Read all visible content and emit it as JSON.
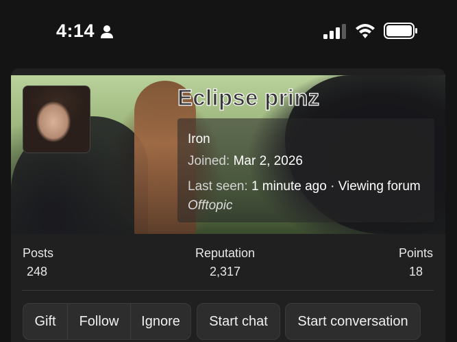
{
  "status_bar": {
    "time": "4:14"
  },
  "profile": {
    "username": "Eclipse prinz",
    "user_title": "Iron",
    "joined_label": "Joined:",
    "joined_value": "Mar 2, 2026",
    "last_seen_label": "Last seen:",
    "last_seen_value": "1 minute ago · Viewing forum",
    "last_seen_forum": "Offtopic"
  },
  "stats": [
    {
      "label": "Posts",
      "value": "248"
    },
    {
      "label": "Reputation",
      "value": "2,317"
    },
    {
      "label": "Points",
      "value": "18"
    }
  ],
  "actions": {
    "gift": "Gift",
    "follow": "Follow",
    "ignore": "Ignore",
    "start_chat": "Start chat",
    "start_conversation": "Start conversation"
  },
  "icons": {
    "person": "person-icon",
    "signal": "cellular-signal-icon",
    "wifi": "wifi-icon",
    "battery": "battery-icon"
  }
}
